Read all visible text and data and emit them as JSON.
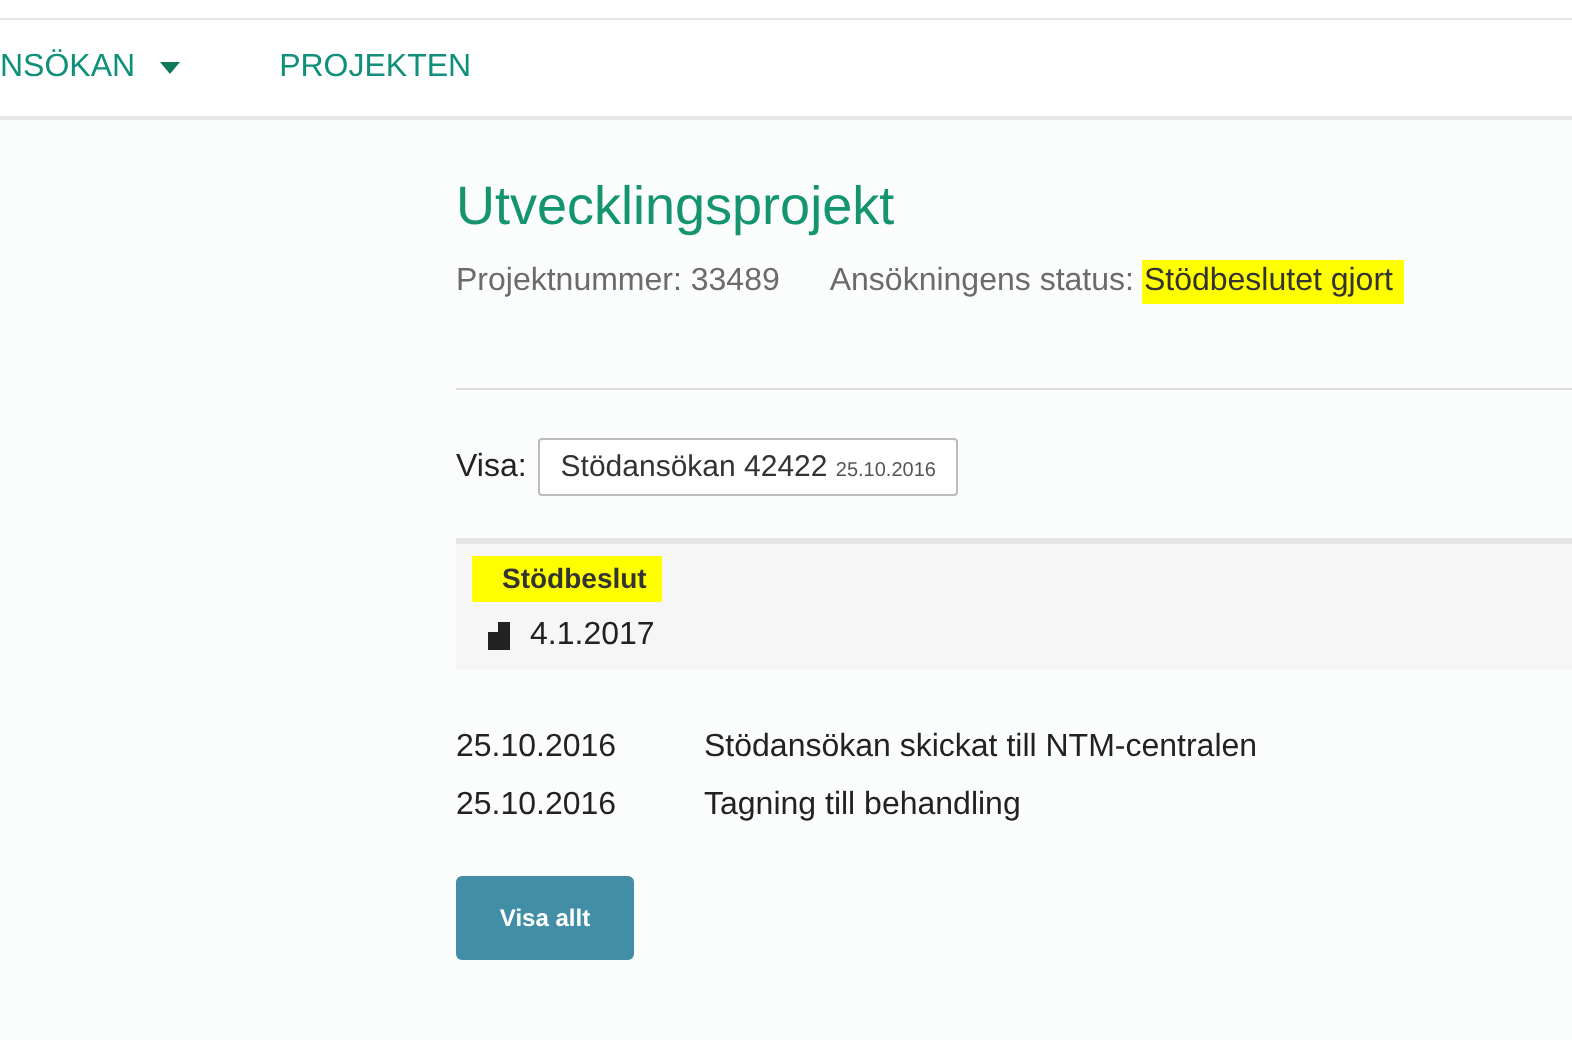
{
  "nav": {
    "items": [
      {
        "label": "NSÖKAN",
        "dropdown": true
      },
      {
        "label": "PROJEKTEN",
        "dropdown": false
      }
    ]
  },
  "title": "Utvecklingsprojekt",
  "project_number": {
    "label": "Projektnummer:",
    "value": "33489"
  },
  "status": {
    "label": "Ansökningens status:",
    "value": "Stödbeslutet gjort",
    "highlighted": true
  },
  "show": {
    "label": "Visa:",
    "value": "Stödansökan 42422",
    "date": "25.10.2016"
  },
  "decision": {
    "title": "Stödbeslut",
    "highlighted": true,
    "date": "4.1.2017"
  },
  "events": [
    {
      "date": "25.10.2016",
      "text": "Stödansökan skickat till NTM-centralen"
    },
    {
      "date": "25.10.2016",
      "text": "Tagning till behandling"
    }
  ],
  "button": "Visa allt"
}
